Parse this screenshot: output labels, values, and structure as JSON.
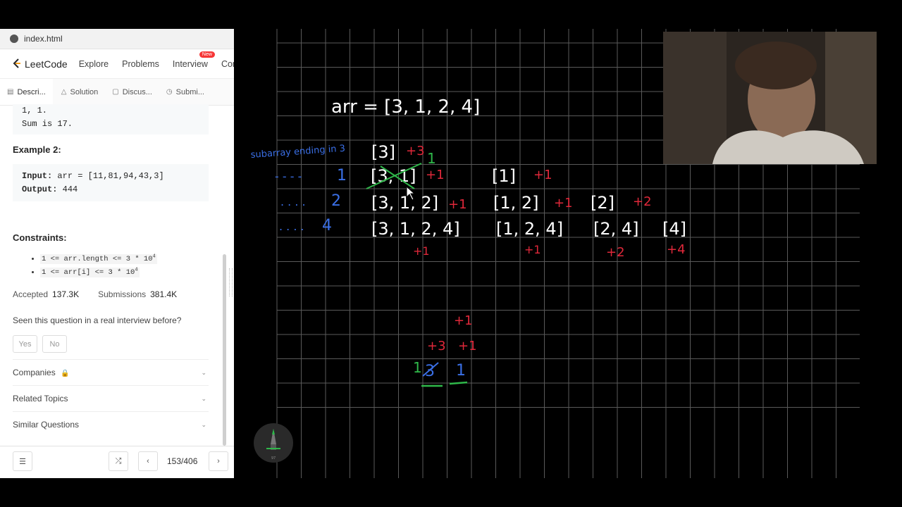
{
  "browser": {
    "tab_title": "index.html"
  },
  "nav": {
    "brand": "LeetCode",
    "items": [
      "Explore",
      "Problems",
      "Interview",
      "Conte"
    ],
    "new_badge": "New"
  },
  "subtabs": [
    {
      "label": "Descri...",
      "icon": "description-icon"
    },
    {
      "label": "Solution",
      "icon": "flask-icon"
    },
    {
      "label": "Discus...",
      "icon": "discuss-icon"
    },
    {
      "label": "Submi...",
      "icon": "clock-icon"
    }
  ],
  "problem": {
    "prev_lines": [
      "1, 1.",
      "Sum is 17."
    ],
    "example2_title": "Example 2:",
    "example2": {
      "input_label": "Input:",
      "input_value": " arr = [11,81,94,43,3]",
      "output_label": "Output:",
      "output_value": " 444"
    },
    "constraints_title": "Constraints:",
    "constraints": [
      {
        "text": "1 <= arr.length <= 3 * 10",
        "exp": "4"
      },
      {
        "text": "1 <= arr[i] <= 3 * 10",
        "exp": "4"
      }
    ],
    "accepted_label": "Accepted",
    "accepted_value": "137.3K",
    "submissions_label": "Submissions",
    "submissions_value": "381.4K",
    "interview_question": "Seen this question in a real interview before?",
    "yes": "Yes",
    "no": "No",
    "sections": [
      "Companies",
      "Related Topics",
      "Similar Questions"
    ]
  },
  "footer": {
    "pager": "153/406"
  },
  "whiteboard": {
    "arr_label": "arr = [3, 1, 2, 4]",
    "annotation_label": "subarray ending in 3",
    "left_markers": [
      "1",
      "2",
      "4"
    ],
    "colors": {
      "white": "#ffffff",
      "red": "#e0283a",
      "blue": "#3a6fe6",
      "green": "#2fb84a"
    }
  },
  "pen_tool": {
    "label": "97"
  }
}
